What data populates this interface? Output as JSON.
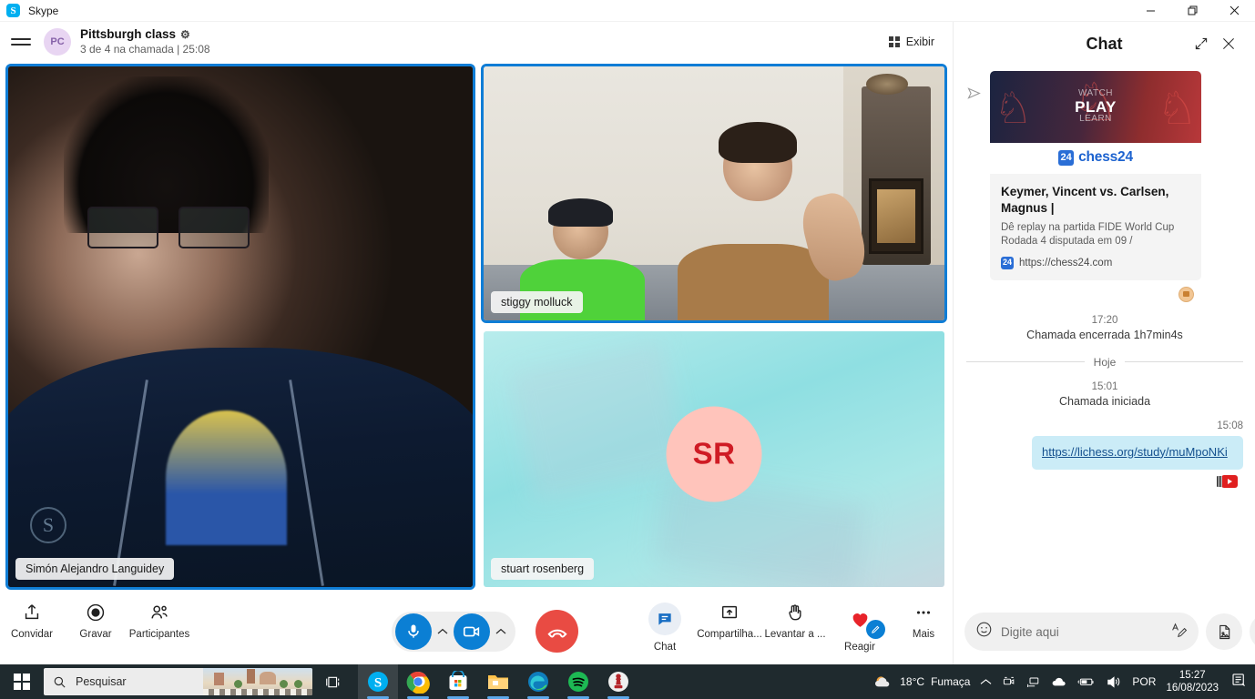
{
  "window": {
    "app_name": "Skype",
    "logo_letter": "S",
    "minimize_icon": "minimize-icon",
    "restore_icon": "restore-icon",
    "close_icon": "close-icon"
  },
  "call_header": {
    "menu_icon": "hamburger-menu-icon",
    "avatar_initials": "PC",
    "title": "Pittsburgh class",
    "settings_icon": "gear-icon",
    "subtitle": "3 de 4 na chamada | 25:08",
    "view_button_label": "Exibir",
    "view_button_icon": "grid-view-icon"
  },
  "video_tiles": [
    {
      "name": "Simón Alejandro Languidey",
      "kind": "video",
      "active_border": "#0f7dd6"
    },
    {
      "name": "stiggy molluck",
      "kind": "video",
      "active_border": "#0f7dd6"
    },
    {
      "name": "stuart rosenberg",
      "kind": "avatar",
      "avatar_initials": "SR",
      "avatar_bg": "#ffc4bb",
      "avatar_fg": "#cf1b24"
    }
  ],
  "toolbar": {
    "left": [
      {
        "label": "Convidar",
        "icon": "share-invite-icon"
      },
      {
        "label": "Gravar",
        "icon": "record-icon"
      },
      {
        "label": "Participantes",
        "icon": "participants-icon"
      }
    ],
    "mic_icon": "microphone-icon",
    "mic_chevron_icon": "chevron-up-icon",
    "camera_icon": "camera-icon",
    "camera_chevron_icon": "chevron-up-icon",
    "hangup_icon": "end-call-icon",
    "hangup_color": "#e94b43",
    "accent_color": "#0b7fd4",
    "right": [
      {
        "label": "Chat",
        "icon": "chat-bubble-icon",
        "active": true
      },
      {
        "label": "Compartilha...",
        "icon": "share-screen-icon",
        "active": false
      },
      {
        "label": "Levantar a ...",
        "icon": "raise-hand-icon",
        "active": false
      },
      {
        "label": "Reagir",
        "icon": "heart-icon",
        "active": false
      },
      {
        "label": "Mais",
        "icon": "more-dots-icon",
        "active": false
      }
    ]
  },
  "chat": {
    "title": "Chat",
    "expand_icon": "expand-icon",
    "close_icon": "close-icon",
    "send_icon": "send-arrow-icon",
    "link_card": {
      "hero_watch": "WATCH",
      "hero_play": "PLAY",
      "hero_learn": "LEARN",
      "brand": "chess24",
      "brand_mark": "24",
      "title": "Keymer, Vincent vs. Carlsen, Magnus |",
      "description": "Dê replay na partida FIDE World Cup Rodada 4 disputada em 09 /",
      "url": "https://chess24.com",
      "reaction_icon": "reaction-badge-icon"
    },
    "events": [
      {
        "time": "17:20",
        "text": "Chamada encerrada 1h7min4s"
      }
    ],
    "day_divider": "Hoje",
    "events2": [
      {
        "time": "15:01",
        "text": "Chamada iniciada"
      }
    ],
    "message": {
      "time": "15:08",
      "text": "https://lichess.org/study/muMpoNKi",
      "reaction_icon": "youtube-reaction-icon"
    },
    "input": {
      "placeholder": "Digite aqui",
      "value": "",
      "emoji_icon": "emoji-smiley-icon",
      "format_icon": "format-text-icon",
      "file_icon": "add-file-icon",
      "more_icon": "more-dots-icon"
    }
  },
  "taskbar": {
    "start_icon": "windows-start-icon",
    "search_placeholder": "Pesquisar",
    "search_icon": "search-icon",
    "taskview_icon": "task-view-icon",
    "apps": [
      {
        "name": "skype-taskbar-icon",
        "active": true
      },
      {
        "name": "chrome-taskbar-icon",
        "active": false
      },
      {
        "name": "microsoft-store-taskbar-icon",
        "active": false
      },
      {
        "name": "file-explorer-taskbar-icon",
        "active": false
      },
      {
        "name": "edge-taskbar-icon",
        "active": false
      },
      {
        "name": "spotify-taskbar-icon",
        "active": false
      },
      {
        "name": "chess-app-taskbar-icon",
        "active": false
      }
    ],
    "weather": {
      "temp": "18°C",
      "condition": "Fumaça",
      "icon": "cloud-smoke-icon"
    },
    "tray_icons": [
      "show-hidden-icons-chevron",
      "camera-tray-icon",
      "network-tray-icon",
      "onedrive-tray-icon",
      "battery-tray-icon",
      "volume-tray-icon"
    ],
    "language": "POR",
    "clock_time": "15:27",
    "clock_date": "16/08/2023",
    "notification_icon": "notifications-icon"
  }
}
